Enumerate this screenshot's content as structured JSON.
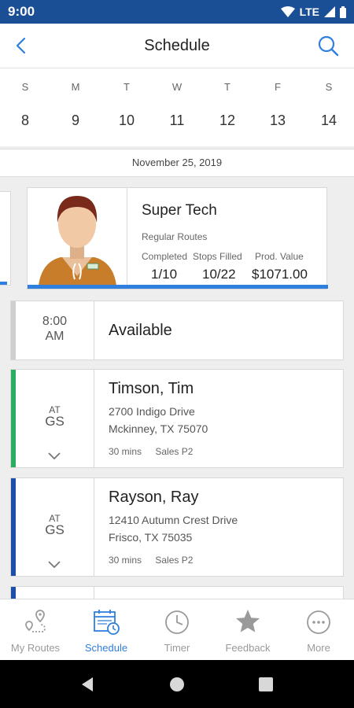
{
  "status": {
    "time": "9:00",
    "network": "LTE"
  },
  "header": {
    "title": "Schedule"
  },
  "week": [
    {
      "dow": "S",
      "num": "8"
    },
    {
      "dow": "M",
      "num": "9"
    },
    {
      "dow": "T",
      "num": "10"
    },
    {
      "dow": "W",
      "num": "11"
    },
    {
      "dow": "T",
      "num": "12"
    },
    {
      "dow": "F",
      "num": "13"
    },
    {
      "dow": "S",
      "num": "14"
    }
  ],
  "date_label": "November 25, 2019",
  "tech": {
    "name": "Super Tech",
    "subtitle": "Regular Routes",
    "stats": [
      {
        "label": "Completed",
        "value": "1/10"
      },
      {
        "label": "Stops Filled",
        "value": "10/22"
      },
      {
        "label": "Prod. Value",
        "value": "$1071.00"
      }
    ],
    "accent": "#2f7fde"
  },
  "appointments": [
    {
      "time_top": "8:00",
      "time_bottom": "AM",
      "title": "Available",
      "strip_color": "#cfcfcf"
    },
    {
      "time_top": "AT",
      "time_bottom": "GS",
      "name": "Timson, Tim",
      "address1": "2700 Indigo Drive",
      "address2": "Mckinney, TX 75070",
      "duration": "30 mins",
      "type": "Sales P2",
      "strip_color": "#27ae60"
    },
    {
      "time_top": "AT",
      "time_bottom": "GS",
      "name": "Rayson, Ray",
      "address1": "12410 Autumn Crest Drive",
      "address2": "Frisco, TX 75035",
      "duration": "30 mins",
      "type": "Sales P2",
      "strip_color": "#1d4fa8"
    }
  ],
  "tabs": [
    {
      "label": "My Routes",
      "icon": "map-pin-route-icon"
    },
    {
      "label": "Schedule",
      "icon": "calendar-clock-icon",
      "active": true
    },
    {
      "label": "Timer",
      "icon": "clock-icon"
    },
    {
      "label": "Feedback",
      "icon": "star-icon"
    },
    {
      "label": "More",
      "icon": "more-dots-icon"
    }
  ],
  "colors": {
    "primary": "#1a4f96",
    "accent": "#2f7fde",
    "tab_inactive": "#9a9a9a"
  }
}
